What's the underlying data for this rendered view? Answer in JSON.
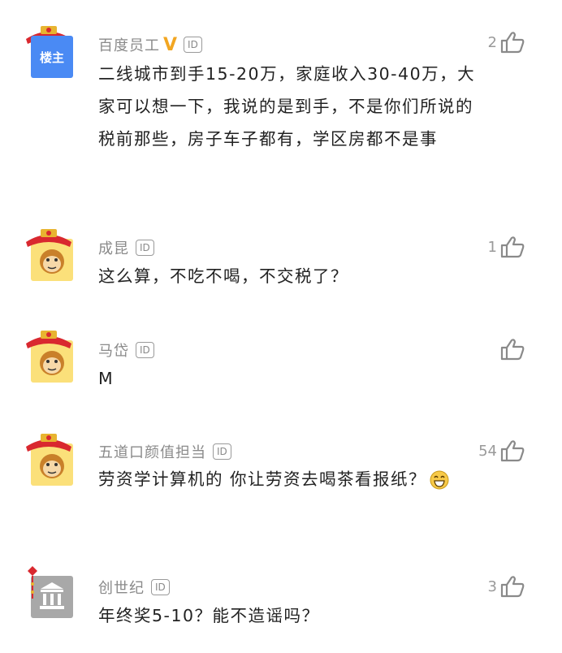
{
  "comments": [
    {
      "username": "百度员工",
      "id_badge": "ID",
      "verified": "V",
      "host_badge": "楼主",
      "likes": "2",
      "text": "二线城市到手15-20万，家庭收入30-40万，大家可以想一下，我说的是到手，不是你们所说的税前那些，房子车子都有，学区房都不是事"
    },
    {
      "username": "成昆",
      "id_badge": "ID",
      "likes": "1",
      "text": "这么算，不吃不喝，不交税了？"
    },
    {
      "username": "马岱",
      "id_badge": "ID",
      "likes": "",
      "text": "M"
    },
    {
      "username": "五道口颜值担当",
      "id_badge": "ID",
      "likes": "54",
      "text": "劳资学计算机的 你让劳资去喝茶看报纸？"
    },
    {
      "username": "创世纪",
      "id_badge": "ID",
      "likes": "3",
      "text": "年终奖5-10？能不造谣吗？"
    }
  ],
  "colors": {
    "host_badge_bg": "#4a8af4",
    "verified": "#f2a622",
    "monkey_bg": "#fbe07a",
    "hat_red": "#d9282f"
  },
  "icons": [
    "thumbs-up-icon",
    "monkey-avatar",
    "bank-avatar",
    "grin-emoji-icon"
  ]
}
